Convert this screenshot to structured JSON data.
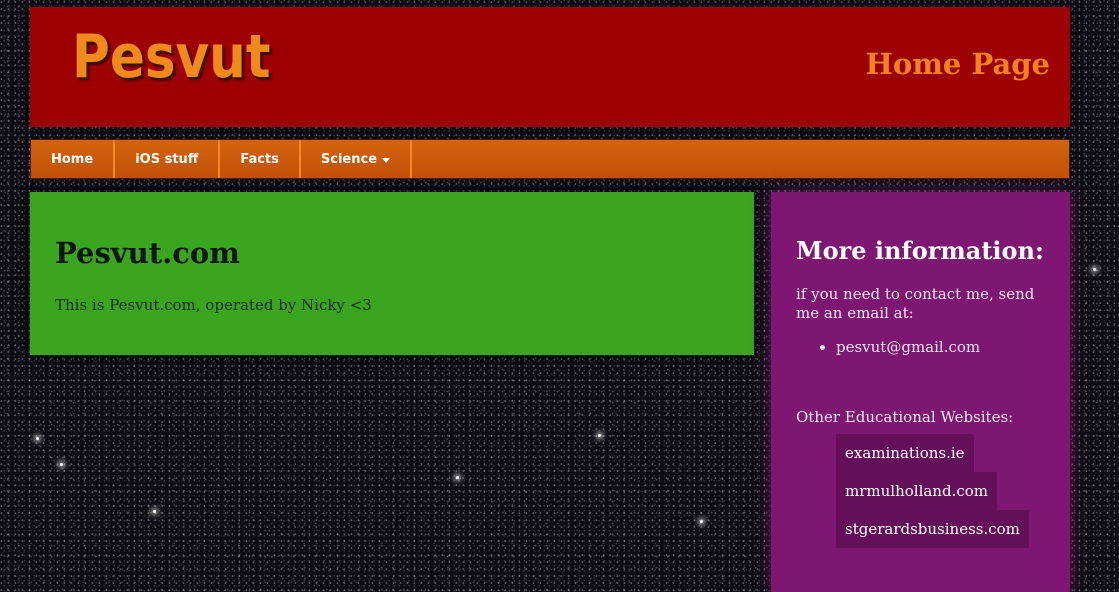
{
  "site": {
    "logo": "Pesvut",
    "page_heading": "Home Page"
  },
  "nav": {
    "items": [
      {
        "label": "Home"
      },
      {
        "label": "iOS stuff"
      },
      {
        "label": "Facts"
      },
      {
        "label": "Science",
        "has_dropdown": true,
        "icon": "caret-down-icon"
      }
    ]
  },
  "main": {
    "title": "Pesvut.com",
    "text": "This is Pesvut.com, operated by Nicky <3"
  },
  "sidebar": {
    "title": "More information:",
    "contact_text": "if you need to contact me, send me an email at:",
    "contact_list": [
      "pesvut@gmail.com"
    ],
    "other_heading": "Other Educational Websites:",
    "links": [
      "examinations.ie",
      "mrmulholland.com",
      "stgerardsbusiness.com"
    ]
  },
  "colors": {
    "header_bg": "#9c0000",
    "nav_bg": "#c85a0a",
    "main_bg": "#3aa51f",
    "sidebar_bg": "#7d1772",
    "accent_orange": "#f2841d"
  }
}
